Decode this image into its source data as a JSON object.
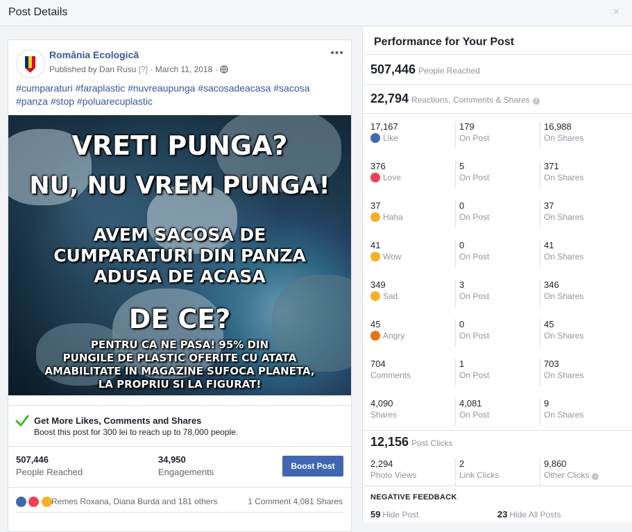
{
  "dialog": {
    "title": "Post Details",
    "close_glyph": "×"
  },
  "post": {
    "page_name": "România Ecologică",
    "published_by": "Published by Dan Rusu",
    "help_marker": "[?]",
    "date": "· March 11, 2018 ·",
    "more_glyph": "•••",
    "hashtags": [
      "#cumparaturi",
      "#faraplastic",
      "#nuvreaupunga",
      "#sacosadeacasa",
      "#sacosa",
      "#panza",
      "#stop",
      "#poluarecuplastic"
    ],
    "image_text": {
      "line1": "VRETI PUNGA?",
      "line2": "NU, NU VREM PUNGA!",
      "line3": "AVEM SACOSA DE",
      "line4": "CUMPARATURI DIN PANZA",
      "line5": "ADUSA DE ACASA",
      "line6": "DE CE?",
      "line7": "PENTRU CA NE PASA! 95% DIN",
      "line8": "PUNGILE DE PLASTIC OFERITE CU ATATA",
      "line9": "AMABILITATE IN MAGAZINE SUFOCA PLANETA,",
      "line10": "LA PROPRIU SI LA FIGURAT!"
    },
    "boost_heading": "Get More Likes, Comments and Shares",
    "boost_sub": "Boost this post for 300 lei to reach up to 78,000 people.",
    "people_reached_num": "507,446",
    "people_reached_label": "People Reached",
    "engagements_num": "34,950",
    "engagements_label": "Engagements",
    "boost_button": "Boost Post",
    "reaction_names": "Remes Roxana, Diana Burda and 181 others",
    "comments_shares": "1 Comment  4,081 Shares"
  },
  "perf": {
    "title": "Performance for Your Post",
    "reached_num": "507,446",
    "reached_label": "People Reached",
    "rcs_num": "22,794",
    "rcs_label": "Reactions, Comments & Shares",
    "on_post": "On Post",
    "on_shares": "On Shares",
    "rows": [
      {
        "total": "17,167",
        "label": "Like",
        "post": "179",
        "shares": "16,988",
        "emoji": "like",
        "color": "#4267b2"
      },
      {
        "total": "376",
        "label": "Love",
        "post": "5",
        "shares": "371",
        "emoji": "love",
        "color": "#f33e58"
      },
      {
        "total": "37",
        "label": "Haha",
        "post": "0",
        "shares": "37",
        "emoji": "haha",
        "color": "#f7b125"
      },
      {
        "total": "41",
        "label": "Wow",
        "post": "0",
        "shares": "41",
        "emoji": "wow",
        "color": "#f7b125"
      },
      {
        "total": "349",
        "label": "Sad",
        "post": "3",
        "shares": "346",
        "emoji": "sad",
        "color": "#f7b125"
      },
      {
        "total": "45",
        "label": "Angry",
        "post": "0",
        "shares": "45",
        "emoji": "angry",
        "color": "#e9710f"
      },
      {
        "total": "704",
        "label": "Comments",
        "post": "1",
        "shares": "703"
      },
      {
        "total": "4,090",
        "label": "Shares",
        "post": "4,081",
        "shares": "9"
      }
    ],
    "clicks_num": "12,156",
    "clicks_label": "Post Clicks",
    "photo_views_num": "2,294",
    "photo_views_label": "Photo Views",
    "link_clicks_num": "2",
    "link_clicks_label": "Link Clicks",
    "other_clicks_num": "9,860",
    "other_clicks_label": "Other Clicks",
    "negative_title": "NEGATIVE FEEDBACK",
    "hide_post_num": "59",
    "hide_post_label": "Hide Post",
    "hide_all_num": "23",
    "hide_all_label": "Hide All Posts"
  }
}
